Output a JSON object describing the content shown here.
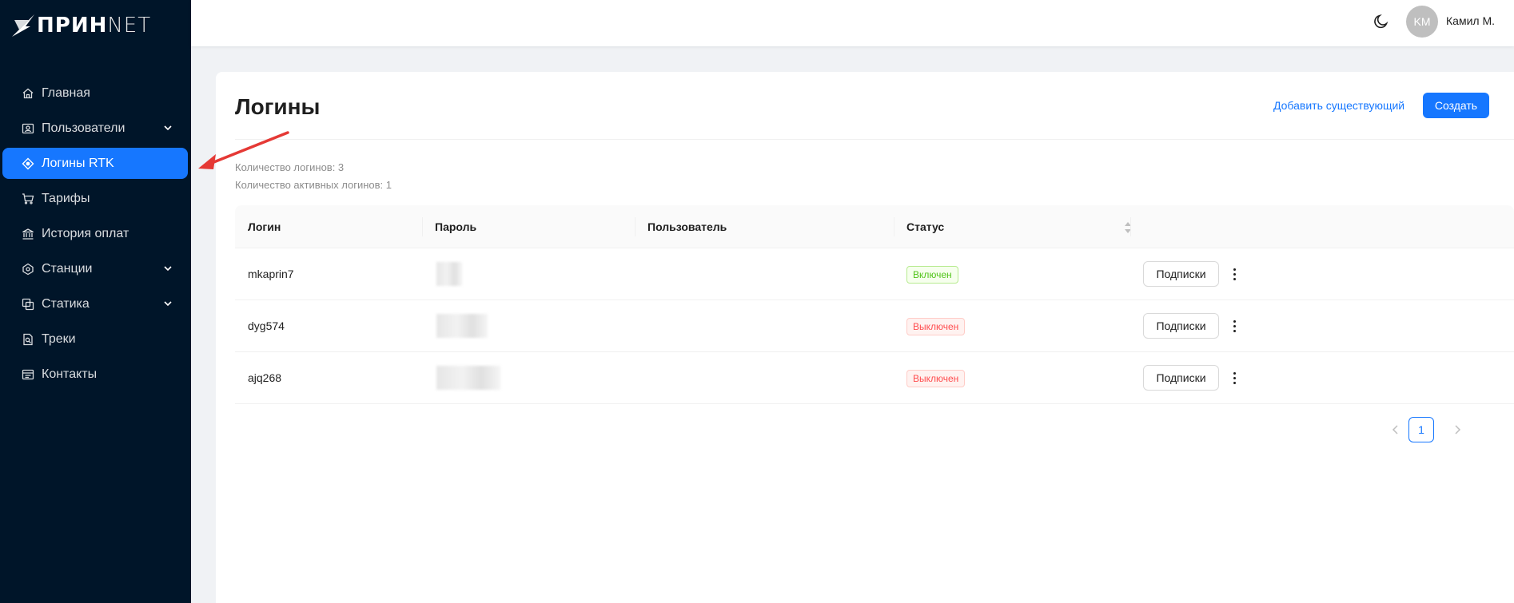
{
  "logo": {
    "bold": "ПРИН",
    "light": "NET"
  },
  "sidebar": {
    "items": [
      {
        "label": "Главная",
        "icon": "home-icon",
        "expandable": false,
        "active": false
      },
      {
        "label": "Пользователи",
        "icon": "users-icon",
        "expandable": true,
        "active": false
      },
      {
        "label": "Логины RTK",
        "icon": "target-icon",
        "expandable": false,
        "active": true
      },
      {
        "label": "Тарифы",
        "icon": "cart-icon",
        "expandable": false,
        "active": false
      },
      {
        "label": "История оплат",
        "icon": "bank-icon",
        "expandable": false,
        "active": false
      },
      {
        "label": "Станции",
        "icon": "station-icon",
        "expandable": true,
        "active": false
      },
      {
        "label": "Статика",
        "icon": "static-icon",
        "expandable": true,
        "active": false
      },
      {
        "label": "Треки",
        "icon": "tracks-icon",
        "expandable": false,
        "active": false
      },
      {
        "label": "Контакты",
        "icon": "contacts-icon",
        "expandable": false,
        "active": false
      }
    ]
  },
  "header": {
    "theme_icon": "moon-icon",
    "avatar_initials": "KM",
    "user_name": "Камил М."
  },
  "page": {
    "title": "Логины",
    "add_existing": "Добавить существующий",
    "create": "Создать",
    "stats": {
      "logins_count": "Количество логинов: 3",
      "active_logins_count": "Количество активных логинов: 1"
    }
  },
  "table": {
    "columns": [
      "Логин",
      "Пароль",
      "Пользователь",
      "Статус"
    ],
    "rows": [
      {
        "login": "mkaprin7",
        "user": "",
        "status": "Включен",
        "status_type": "on",
        "action": "Подписки"
      },
      {
        "login": "dyg574",
        "user": "",
        "status": "Выключен",
        "status_type": "off",
        "action": "Подписки"
      },
      {
        "login": "ajq268",
        "user": "",
        "status": "Выключен",
        "status_type": "off",
        "action": "Подписки"
      }
    ]
  },
  "pagination": {
    "current": "1"
  },
  "colors": {
    "sidebar_bg": "#001529",
    "primary": "#1677ff",
    "success": "#52c41a",
    "danger": "#ff4d4f",
    "annotation_arrow": "#e53935"
  }
}
